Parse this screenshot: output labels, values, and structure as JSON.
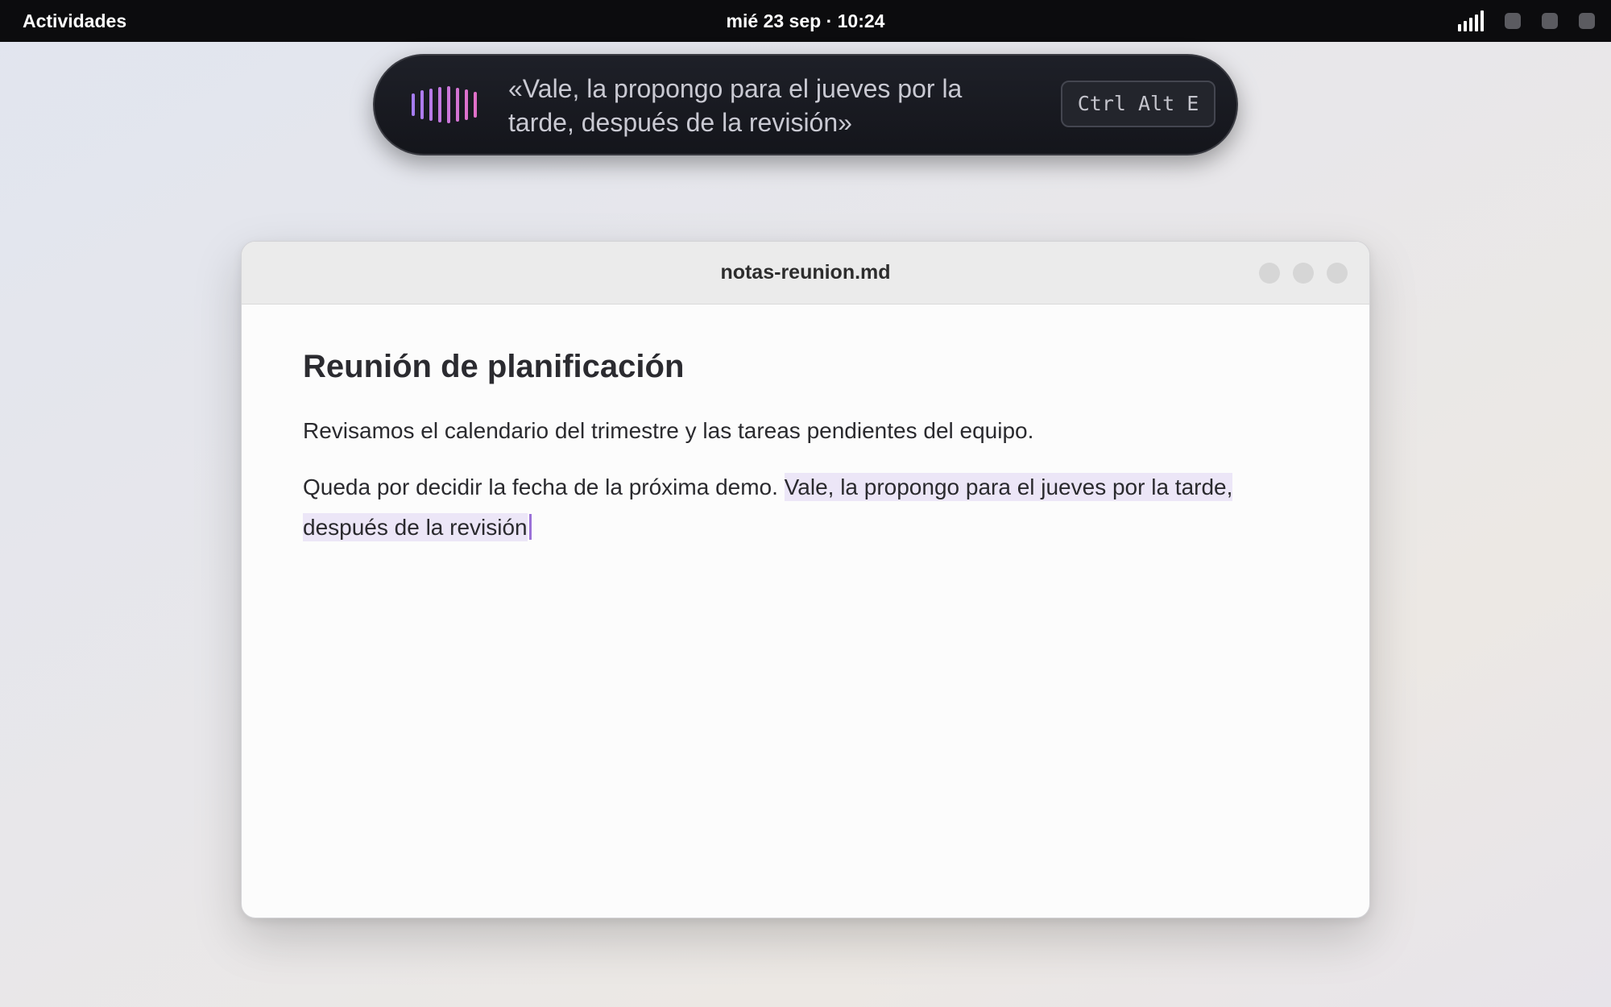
{
  "top_bar": {
    "activities_label": "Actividades",
    "clock": "mié 23 sep · 10:24",
    "tray_icons": [
      "signal-icon",
      "tray-square-icon",
      "tray-square-icon",
      "tray-square-icon"
    ]
  },
  "dictation": {
    "transcript": "«Vale, la propongo para el jueves por la tarde, después de la revisión»",
    "shortcut": "Ctrl Alt E",
    "waveform_colors": [
      "#a57cf2",
      "#e070c8"
    ]
  },
  "window": {
    "title": "notas-reunion.md"
  },
  "document": {
    "heading": "Reunión de planificación",
    "paragraph1": "Revisamos el calendario del trimestre y las tareas pendientes del equipo.",
    "paragraph2_prefix": "Queda por decidir la fecha de la próxima demo.",
    "paragraph2_dictated": "Vale, la propongo para el jueves por la tarde, después de la revisión"
  },
  "colors": {
    "topbar": "#0c0c0e",
    "pill_background": "#1a1b21",
    "dictated_highlight": "#ece6f7",
    "caret": "#9b72d8"
  }
}
